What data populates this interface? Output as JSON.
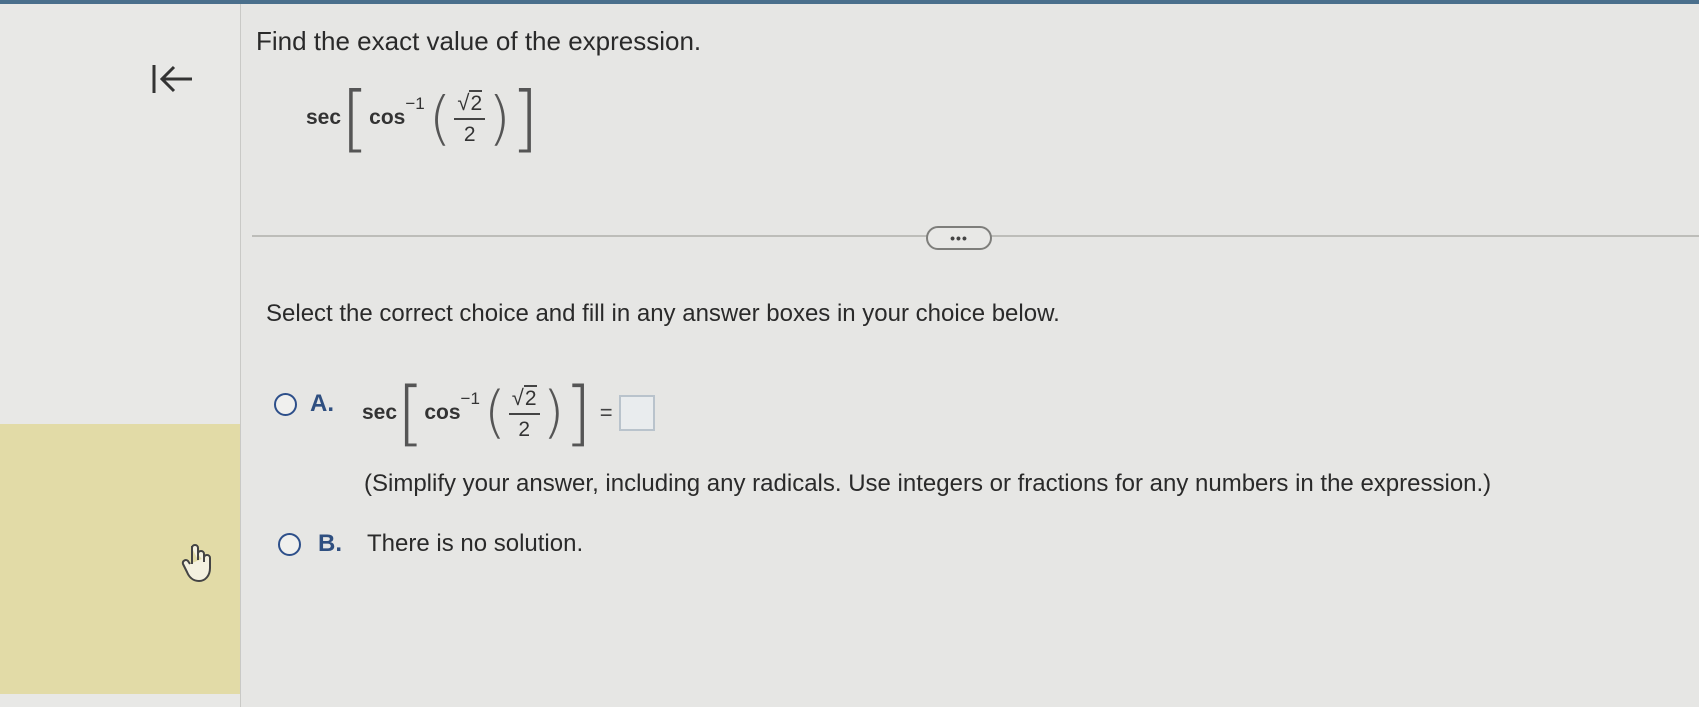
{
  "question": {
    "title": "Find the exact value of the expression.",
    "expression": {
      "outer_fn": "sec",
      "inner_fn": "cos",
      "exponent": "−1",
      "numerator_radical": "2",
      "denominator": "2"
    }
  },
  "more_button_label": "•••",
  "instruction": "Select the correct choice and fill in any answer boxes in your choice below.",
  "choices": {
    "a": {
      "letter": "A.",
      "outer_fn": "sec",
      "inner_fn": "cos",
      "exponent": "−1",
      "numerator_radical": "2",
      "denominator": "2",
      "equals": "=",
      "answer_value": "",
      "hint": "(Simplify your answer, including any radicals. Use integers or fractions for any numbers in the expression.)"
    },
    "b": {
      "letter": "B.",
      "text": "There is no solution."
    }
  },
  "icons": {
    "collapse": "collapse-left-icon",
    "cursor": "hand-pointer-icon"
  },
  "colors": {
    "accent": "#2d4f8a",
    "highlight_panel": "#e2dba7"
  }
}
